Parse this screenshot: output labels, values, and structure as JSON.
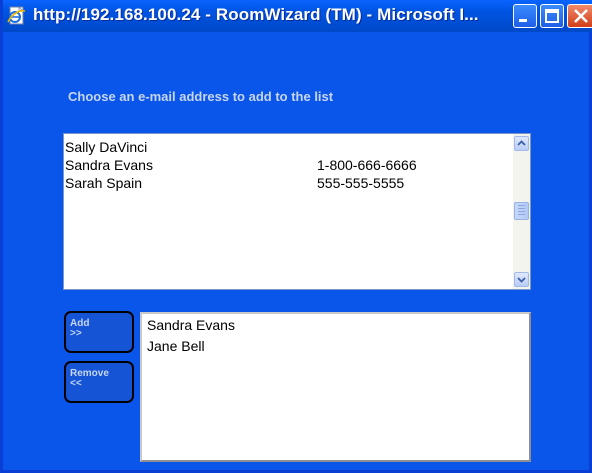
{
  "window": {
    "title": "http://192.168.100.24 - RoomWizard (TM) - Microsoft I...",
    "title_icon": "ie-page-icon",
    "accent_color": "#0a55ea"
  },
  "heading": "Choose an e-mail address to add to the list",
  "contacts": [
    {
      "name": "Sally DaVinci",
      "phone": ""
    },
    {
      "name": "Sandra Evans",
      "phone": "1-800-666-6666"
    },
    {
      "name": "Sarah Spain",
      "phone": "555-555-5555"
    }
  ],
  "buttons": {
    "add": {
      "line1": "Add",
      "line2": ">>"
    },
    "remove": {
      "line1": "Remove",
      "line2": "<<"
    }
  },
  "selected": [
    "Sandra Evans",
    "Jane Bell"
  ]
}
